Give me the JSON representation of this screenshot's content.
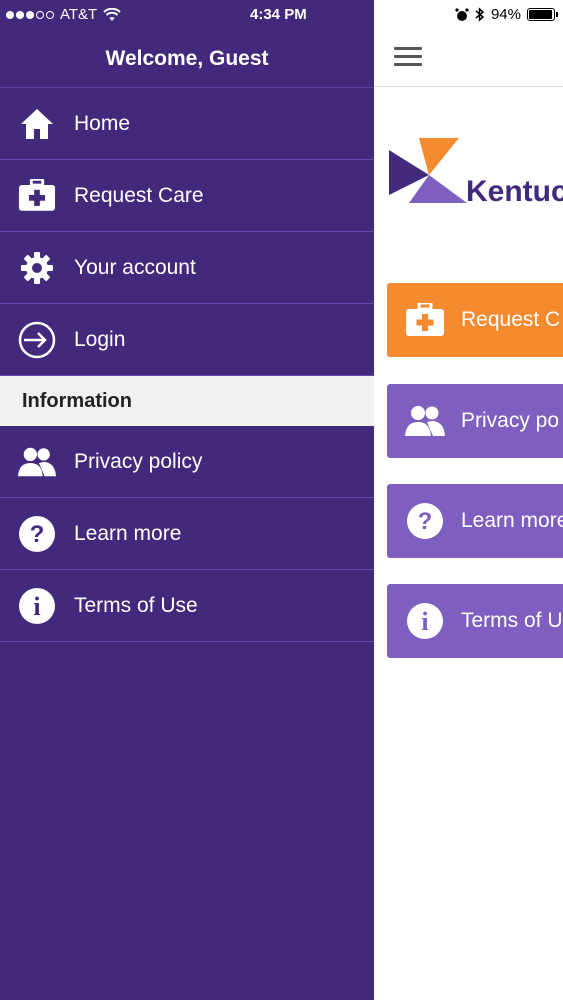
{
  "status_bar": {
    "carrier": "AT&T",
    "time": "4:34 PM",
    "battery": "94%",
    "battery_level": 0.94
  },
  "drawer": {
    "title": "Welcome, Guest",
    "items": [
      {
        "label": "Home",
        "icon": "home-icon"
      },
      {
        "label": "Request Care",
        "icon": "medical-kit-icon"
      },
      {
        "label": "Your account",
        "icon": "gear-icon"
      },
      {
        "label": "Login",
        "icon": "login-icon"
      }
    ],
    "section_title": "Information",
    "info_items": [
      {
        "label": "Privacy policy",
        "icon": "users-icon"
      },
      {
        "label": "Learn more",
        "icon": "question-icon"
      },
      {
        "label": "Terms of Use",
        "icon": "info-icon"
      }
    ]
  },
  "main": {
    "logo_text": "Kentuc",
    "cards": [
      {
        "label": "Request C",
        "color": "#f58a2e",
        "icon": "medical-kit-icon"
      },
      {
        "label": "Privacy po",
        "color": "#7e5ebe",
        "icon": "users-icon"
      },
      {
        "label": "Learn more",
        "color": "#7e5ebe",
        "icon": "question-icon"
      },
      {
        "label": "Terms of U",
        "color": "#7e5ebe",
        "icon": "info-icon"
      }
    ]
  },
  "colors": {
    "drawer_bg": "#43297b",
    "accent_orange": "#f58a2e",
    "accent_purple": "#7e5ebe"
  }
}
